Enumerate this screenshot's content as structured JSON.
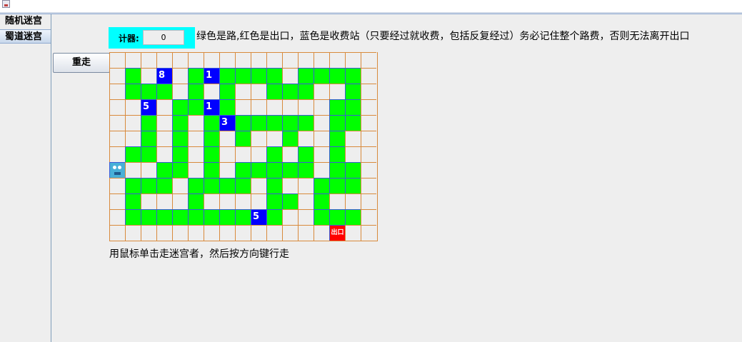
{
  "sidebar": {
    "tabs": [
      "随机迷宫",
      "蜀道迷宫"
    ],
    "selected": 1
  },
  "toolbar": {
    "restart_label": "重走"
  },
  "counter": {
    "label": "计器:",
    "value": "0"
  },
  "instructions": "绿色是路,红色是出口，蓝色是收费站（只要经过就收费，包括反复经过）务必记住整个路费，否则无法离开出口",
  "hint": "用鼠标单击走迷宫者，然后按方向键行走",
  "maze": {
    "columns": 17,
    "rows": [
      ". . . . . . . . . . . . . . . . .",
      ". R . 8 . R 1 R R R R . R R R R .",
      ". R R R . R . R . . R R R . . R .",
      ". . 5 . R R 1 R . . . . . . R R .",
      ". . R . R . R 3 R R R R R . R R .",
      ". . R . R . R . R . . R . . R . .",
      ". R R . R . R . . . R . R . R . .",
      "P . . R R . R . R R R R R . R R .",
      ". R R R . R R R R . R . . R R R .",
      ". R . . . R . . . . R R . R . . .",
      ". R R R R R R R R 5 R . . R R R .",
      ". . . . . . . . . . . . . . E . ."
    ],
    "legend": {
      "road": "R",
      "toll": "digit",
      "exit": "E",
      "player": "P"
    },
    "exit_label": "出口",
    "colors": {
      "road": "#00ff00",
      "toll": "#0000ff",
      "exit": "#ff0000",
      "empty": "#eeeeee",
      "grid": "#d88a3c",
      "counter_bg": "#00ffff"
    }
  }
}
